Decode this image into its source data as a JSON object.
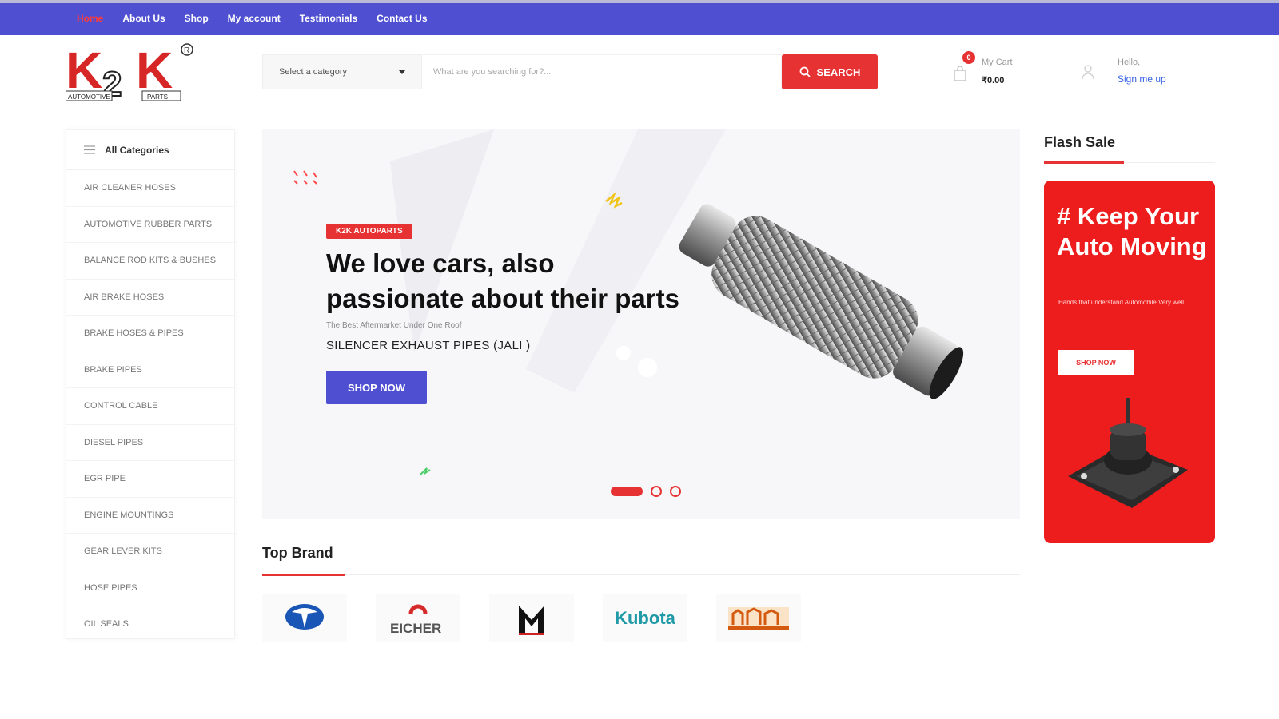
{
  "nav": {
    "items": [
      "Home",
      "About Us",
      "Shop",
      "My account",
      "Testimonials",
      "Contact Us"
    ],
    "active_index": 0
  },
  "logo": {
    "text_main": "K2K",
    "text_left": "AUTOMOTIVE",
    "text_right": "PARTS",
    "registered": "®"
  },
  "search": {
    "category_label": "Select a category",
    "placeholder": "What are you searching for?...",
    "button_label": "SEARCH"
  },
  "cart": {
    "badge": "0",
    "label": "My Cart",
    "total": "₹0.00"
  },
  "account": {
    "greeting": "Hello,",
    "link": "Sign me up"
  },
  "sidebar": {
    "title": "All Categories",
    "items": [
      "AIR CLEANER HOSES",
      "AUTOMOTIVE RUBBER PARTS",
      "BALANCE ROD KITS & BUSHES",
      "AIR BRAKE HOSES",
      "BRAKE HOSES & PIPES",
      "BRAKE PIPES",
      "CONTROL CABLE",
      "DIESEL PIPES",
      "EGR PIPE",
      "ENGINE MOUNTINGS",
      "GEAR LEVER KITS",
      "HOSE PIPES",
      "OIL SEALS"
    ]
  },
  "hero": {
    "tag": "K2K AUTOPARTS",
    "title": "We love cars, also passionate about their parts",
    "subtitle": "The Best Aftermarket Under One Roof",
    "product": "SILENCER EXHAUST PIPES (JALI )",
    "button": "SHOP NOW",
    "slides": 3,
    "active_slide": 0
  },
  "flash_sale": {
    "title": "Flash Sale",
    "headline": "# Keep Your Auto Moving",
    "subtext": "Hands that understand Automobile Very well",
    "button": "SHOP NOW"
  },
  "brands": {
    "title": "Top Brand",
    "items": [
      "TATA",
      "EICHER",
      "MAHINDRA",
      "Kubota",
      "SONALIKA"
    ]
  },
  "colors": {
    "nav_bg": "#4f4fd1",
    "accent": "#e63232",
    "link": "#3b66e6"
  }
}
